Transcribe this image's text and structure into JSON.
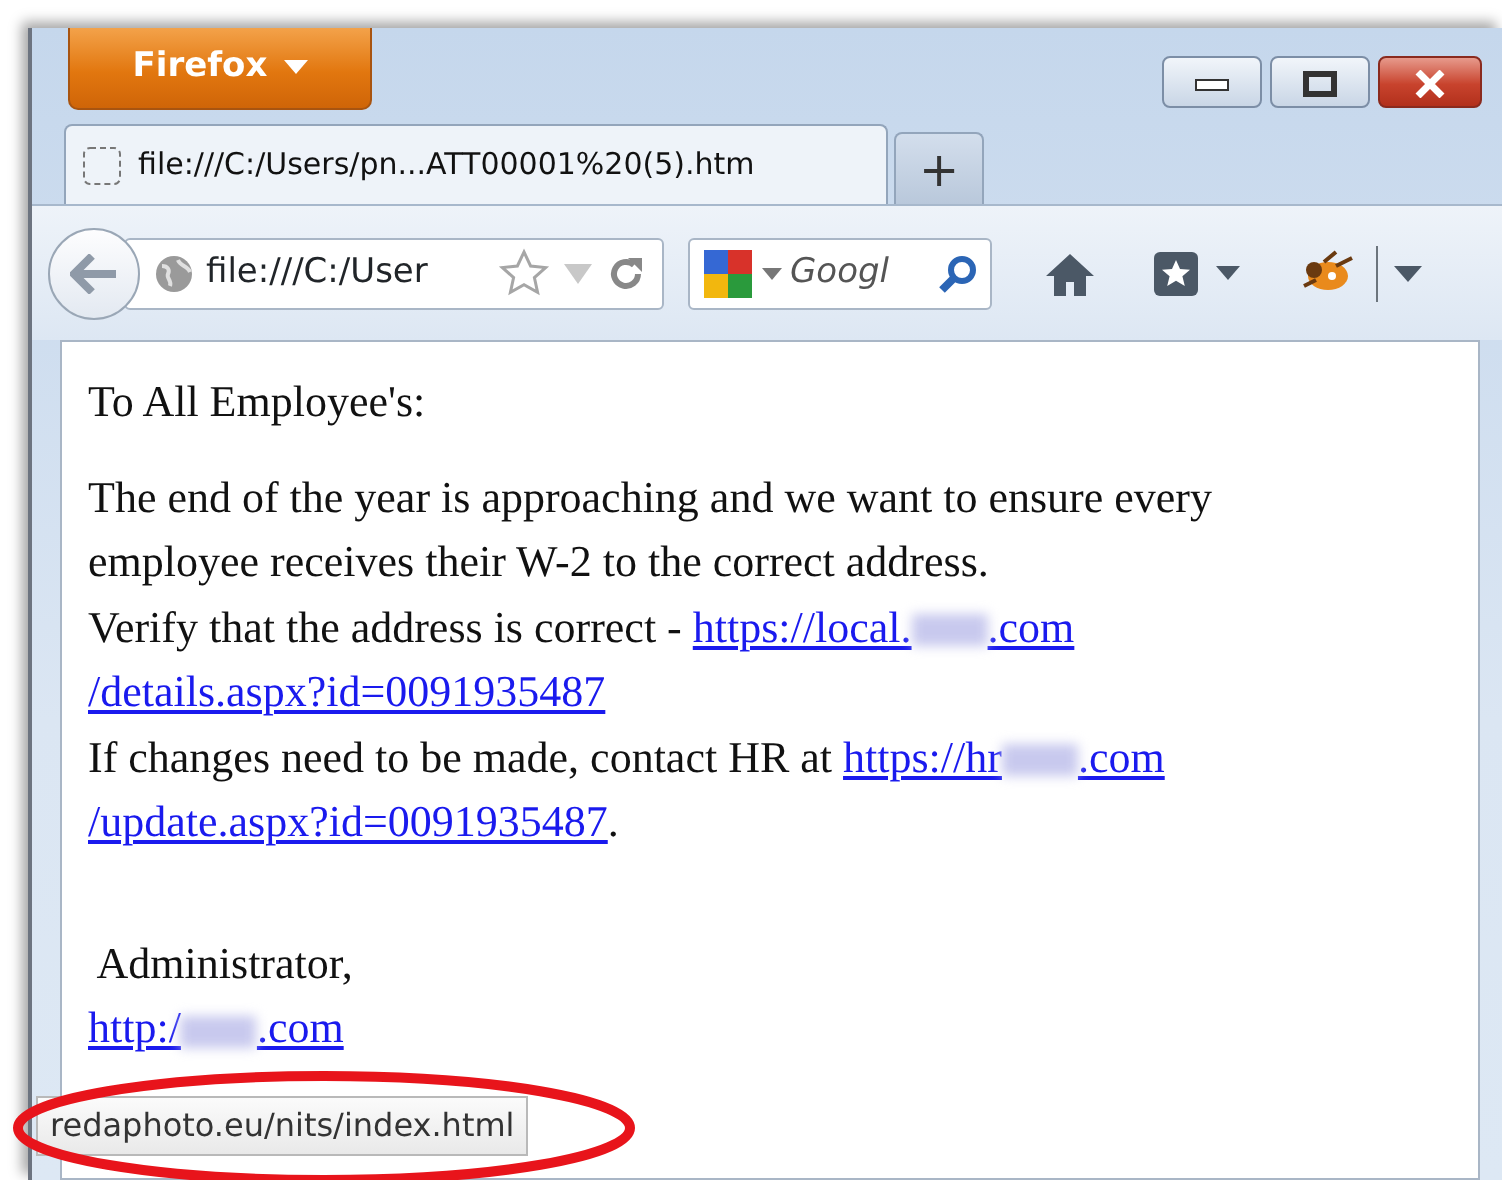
{
  "browser": {
    "menu_button": "Firefox",
    "tabs": [
      {
        "title": "file:///C:/Users/pn...ATT00001%20(5).htm",
        "selected": true
      }
    ],
    "new_tab": "+",
    "address": "file:///C:/User",
    "search_placeholder": "Googl"
  },
  "page": {
    "blocks": [
      [
        [
          {
            "kind": "text",
            "text": "To All Employee's:"
          }
        ]
      ],
      [
        [
          {
            "kind": "text",
            "text": "The end of the year is approaching and we want to ensure every"
          }
        ],
        [
          {
            "kind": "text",
            "text": "employee receives their W-2 to the correct address."
          }
        ],
        [
          {
            "kind": "text",
            "text": "Verify that the address is correct - "
          },
          {
            "kind": "link",
            "parts": [
              {
                "kind": "text",
                "text": "https://local."
              },
              {
                "kind": "redacted"
              },
              {
                "kind": "text",
                "text": ".com"
              }
            ]
          }
        ],
        [
          {
            "kind": "link",
            "parts": [
              {
                "kind": "text",
                "text": "/details.aspx?id=0091935487"
              }
            ]
          }
        ],
        [
          {
            "kind": "text",
            "text": "If changes need to be made, contact HR at "
          },
          {
            "kind": "link",
            "parts": [
              {
                "kind": "text",
                "text": "https://hr"
              },
              {
                "kind": "redacted"
              },
              {
                "kind": "text",
                "text": ".com"
              }
            ]
          }
        ],
        [
          {
            "kind": "link",
            "parts": [
              {
                "kind": "text",
                "text": "/update.aspx?id=0091935487"
              }
            ]
          },
          {
            "kind": "text",
            "text": "."
          }
        ]
      ],
      [
        [
          {
            "kind": "text",
            "text": " Administrator,"
          }
        ],
        [
          {
            "kind": "link",
            "parts": [
              {
                "kind": "text",
                "text": "http:/"
              },
              {
                "kind": "redacted"
              },
              {
                "kind": "text",
                "text": ".com"
              }
            ]
          }
        ]
      ]
    ]
  },
  "status_tooltip": "redaphoto.eu/nits/index.html",
  "annotations": [
    {
      "kind": "ellipse"
    }
  ]
}
